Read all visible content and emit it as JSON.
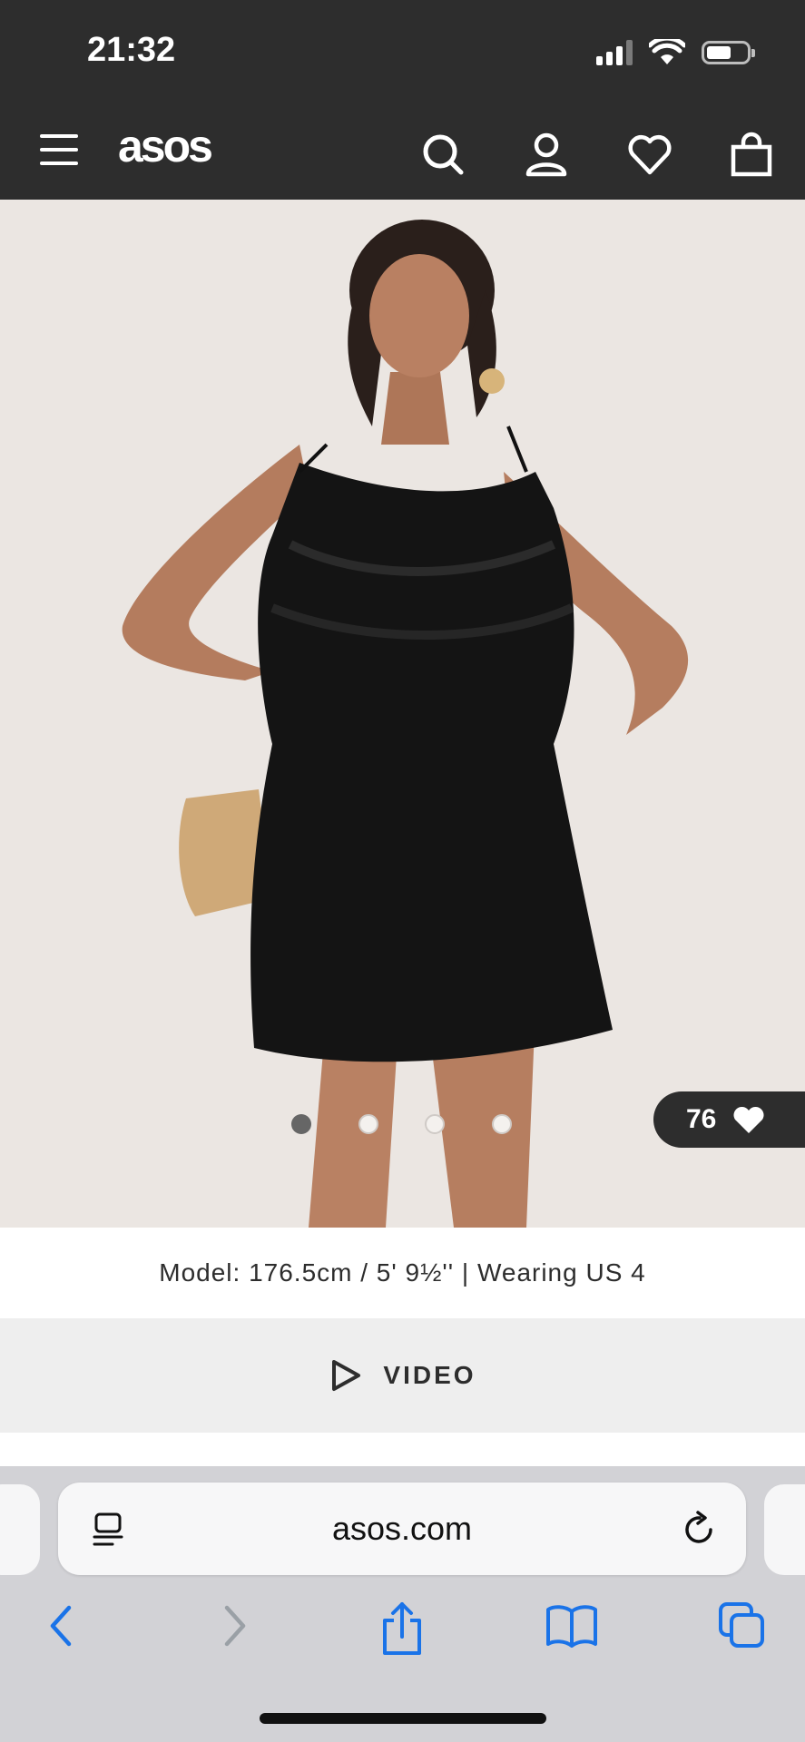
{
  "status_bar": {
    "time": "21:32",
    "icons": [
      "cellular-signal-icon",
      "wifi-icon",
      "battery-icon"
    ]
  },
  "header": {
    "logo": "asos",
    "icons": [
      "menu-icon",
      "search-icon",
      "account-icon",
      "wishlist-heart-icon",
      "shopping-bag-icon"
    ],
    "background": "#2d2d2d"
  },
  "product_gallery": {
    "image_alt_subject": "woman-in-black-ruffle-mini-dress",
    "total_images": 4,
    "active_index": 0,
    "saved_count": "76"
  },
  "model_info": "Model: 176.5cm / 5' 9½'' | Wearing US 4",
  "video_button": {
    "label": "VIDEO"
  },
  "browser": {
    "url": "asos.com",
    "toolbar": [
      "back-icon",
      "forward-icon",
      "share-icon",
      "bookmarks-icon",
      "tabs-icon"
    ],
    "accent": "#1a73e8"
  }
}
